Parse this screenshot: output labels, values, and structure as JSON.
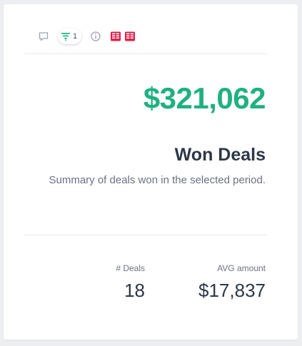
{
  "toolbar": {
    "filter_count": "1",
    "icons": [
      "comment-icon",
      "filter-icon",
      "info-icon",
      "database-icon",
      "database-icon"
    ],
    "colors": {
      "filter": "#1fb17f",
      "database": "#e11d48",
      "muted": "#9ca3af"
    }
  },
  "metric": {
    "amount": "$321,062",
    "amount_color": "#1fb17f",
    "title": "Won Deals",
    "subtitle": "Summary of deals won in the selected period."
  },
  "stats": {
    "deals_label": "# Deals",
    "deals_value": "18",
    "avg_label": "AVG amount",
    "avg_value": "$17,837"
  }
}
